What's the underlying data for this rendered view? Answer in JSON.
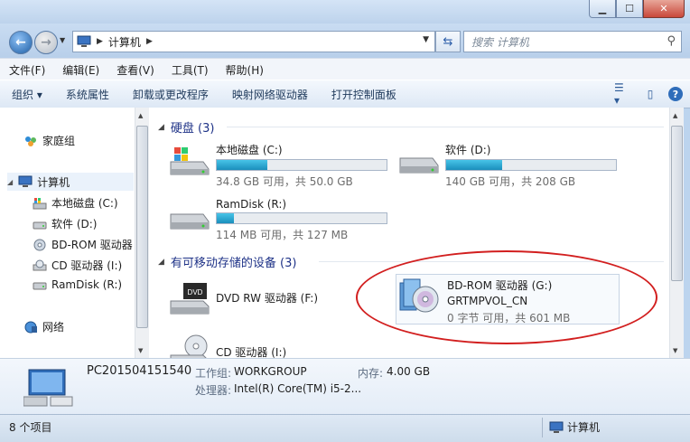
{
  "title_bar": {
    "buttons": [
      "minimize",
      "maximize",
      "close"
    ]
  },
  "nav": {
    "breadcrumb": [
      "计算机"
    ],
    "search_placeholder": "搜索 计算机"
  },
  "menu": [
    "文件(F)",
    "编辑(E)",
    "查看(V)",
    "工具(T)",
    "帮助(H)"
  ],
  "toolbar": {
    "items": [
      "组织 ▾",
      "系统属性",
      "卸载或更改程序",
      "映射网络驱动器",
      "打开控制面板"
    ]
  },
  "sidebar": {
    "items": [
      {
        "label": "家庭组",
        "icon": "homegroup-icon"
      },
      {
        "label": "计算机",
        "icon": "computer-icon"
      },
      {
        "label": "本地磁盘 (C:)",
        "icon": "windows-drive-icon"
      },
      {
        "label": "软件 (D:)",
        "icon": "drive-icon"
      },
      {
        "label": "BD-ROM 驱动器",
        "icon": "bd-rom-icon"
      },
      {
        "label": "CD 驱动器 (I:)",
        "icon": "cd-drive-icon"
      },
      {
        "label": "RamDisk (R:)",
        "icon": "drive-icon"
      },
      {
        "label": "网络",
        "icon": "network-icon"
      }
    ]
  },
  "content": {
    "hard_disks": {
      "header": "硬盘 (3)",
      "drives": [
        {
          "name": "本地磁盘 (C:)",
          "size": "34.8 GB 可用，共 50.0 GB",
          "used_fraction": 0.3
        },
        {
          "name": "软件 (D:)",
          "size": "140 GB 可用，共 208 GB",
          "used_fraction": 0.33
        },
        {
          "name": "RamDisk (R:)",
          "size": "114 MB 可用，共 127 MB",
          "used_fraction": 0.1
        }
      ]
    },
    "removable": {
      "header": "有可移动存储的设备 (3)",
      "devices": [
        {
          "name": "DVD RW 驱动器 (F:)"
        },
        {
          "name": "BD-ROM 驱动器 (G:)",
          "label": "GRTMPVOL_CN",
          "size": "0 字节 可用，共 601 MB"
        },
        {
          "name": "CD 驱动器 (I:)"
        }
      ]
    }
  },
  "details": {
    "computer_name": "PC201504151540",
    "workgroup_label": "工作组:",
    "workgroup": "WORKGROUP",
    "memory_label": "内存:",
    "memory": "4.00 GB",
    "cpu_label": "处理器:",
    "cpu": "Intel(R) Core(TM) i5-2..."
  },
  "status": {
    "count": "8 个项目",
    "location": "计算机"
  },
  "colors": {
    "annotation_circle": "#d21f1f",
    "bar_fill": "#26a0d0"
  }
}
